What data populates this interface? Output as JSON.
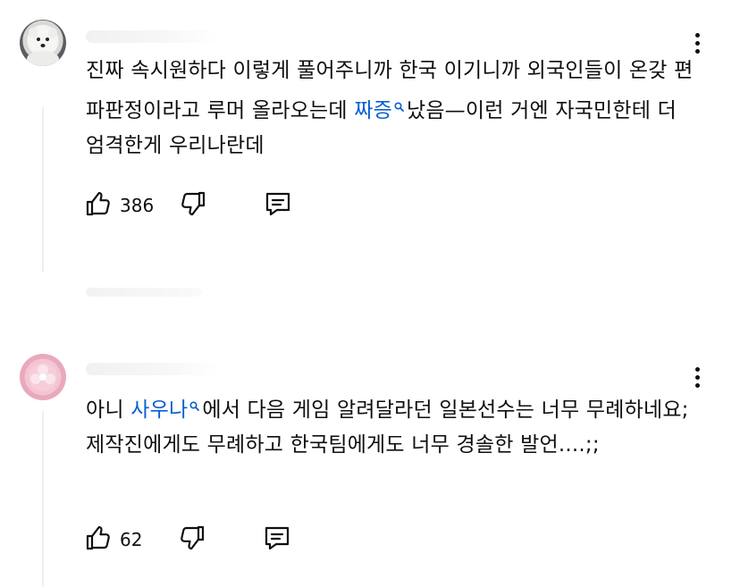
{
  "comments": [
    {
      "avatar": "white-dog-avatar",
      "text_before": "진짜 속시원하다 이렇게 풀어주니까 한국 이기니까 외국인들이 온갖 편파판정이라고 루머 올라오는데 ",
      "link": "짜증",
      "text_after": "났음—이런 거엔 자국민한테 더 엄격한게 우리나란데",
      "likes": "386"
    },
    {
      "avatar": "pink-flower-avatar",
      "text_before": "아니 ",
      "link": "사우나",
      "text_after": "에서 다음 게임 알려달라던 일본선수는 너무 무례하네요; 제작진에게도 무례하고 한국팀에게도 너무 경솔한 발언....;;",
      "likes": "62"
    }
  ],
  "icons": {
    "like": "thumbs-up-icon",
    "dislike": "thumbs-down-icon",
    "reply": "comment-reply-icon",
    "more": "more-vert-icon",
    "search": "search-lens-icon"
  },
  "colors": {
    "text": "#0f0f0f",
    "link": "#065fd4",
    "thread_line": "#efefef"
  }
}
